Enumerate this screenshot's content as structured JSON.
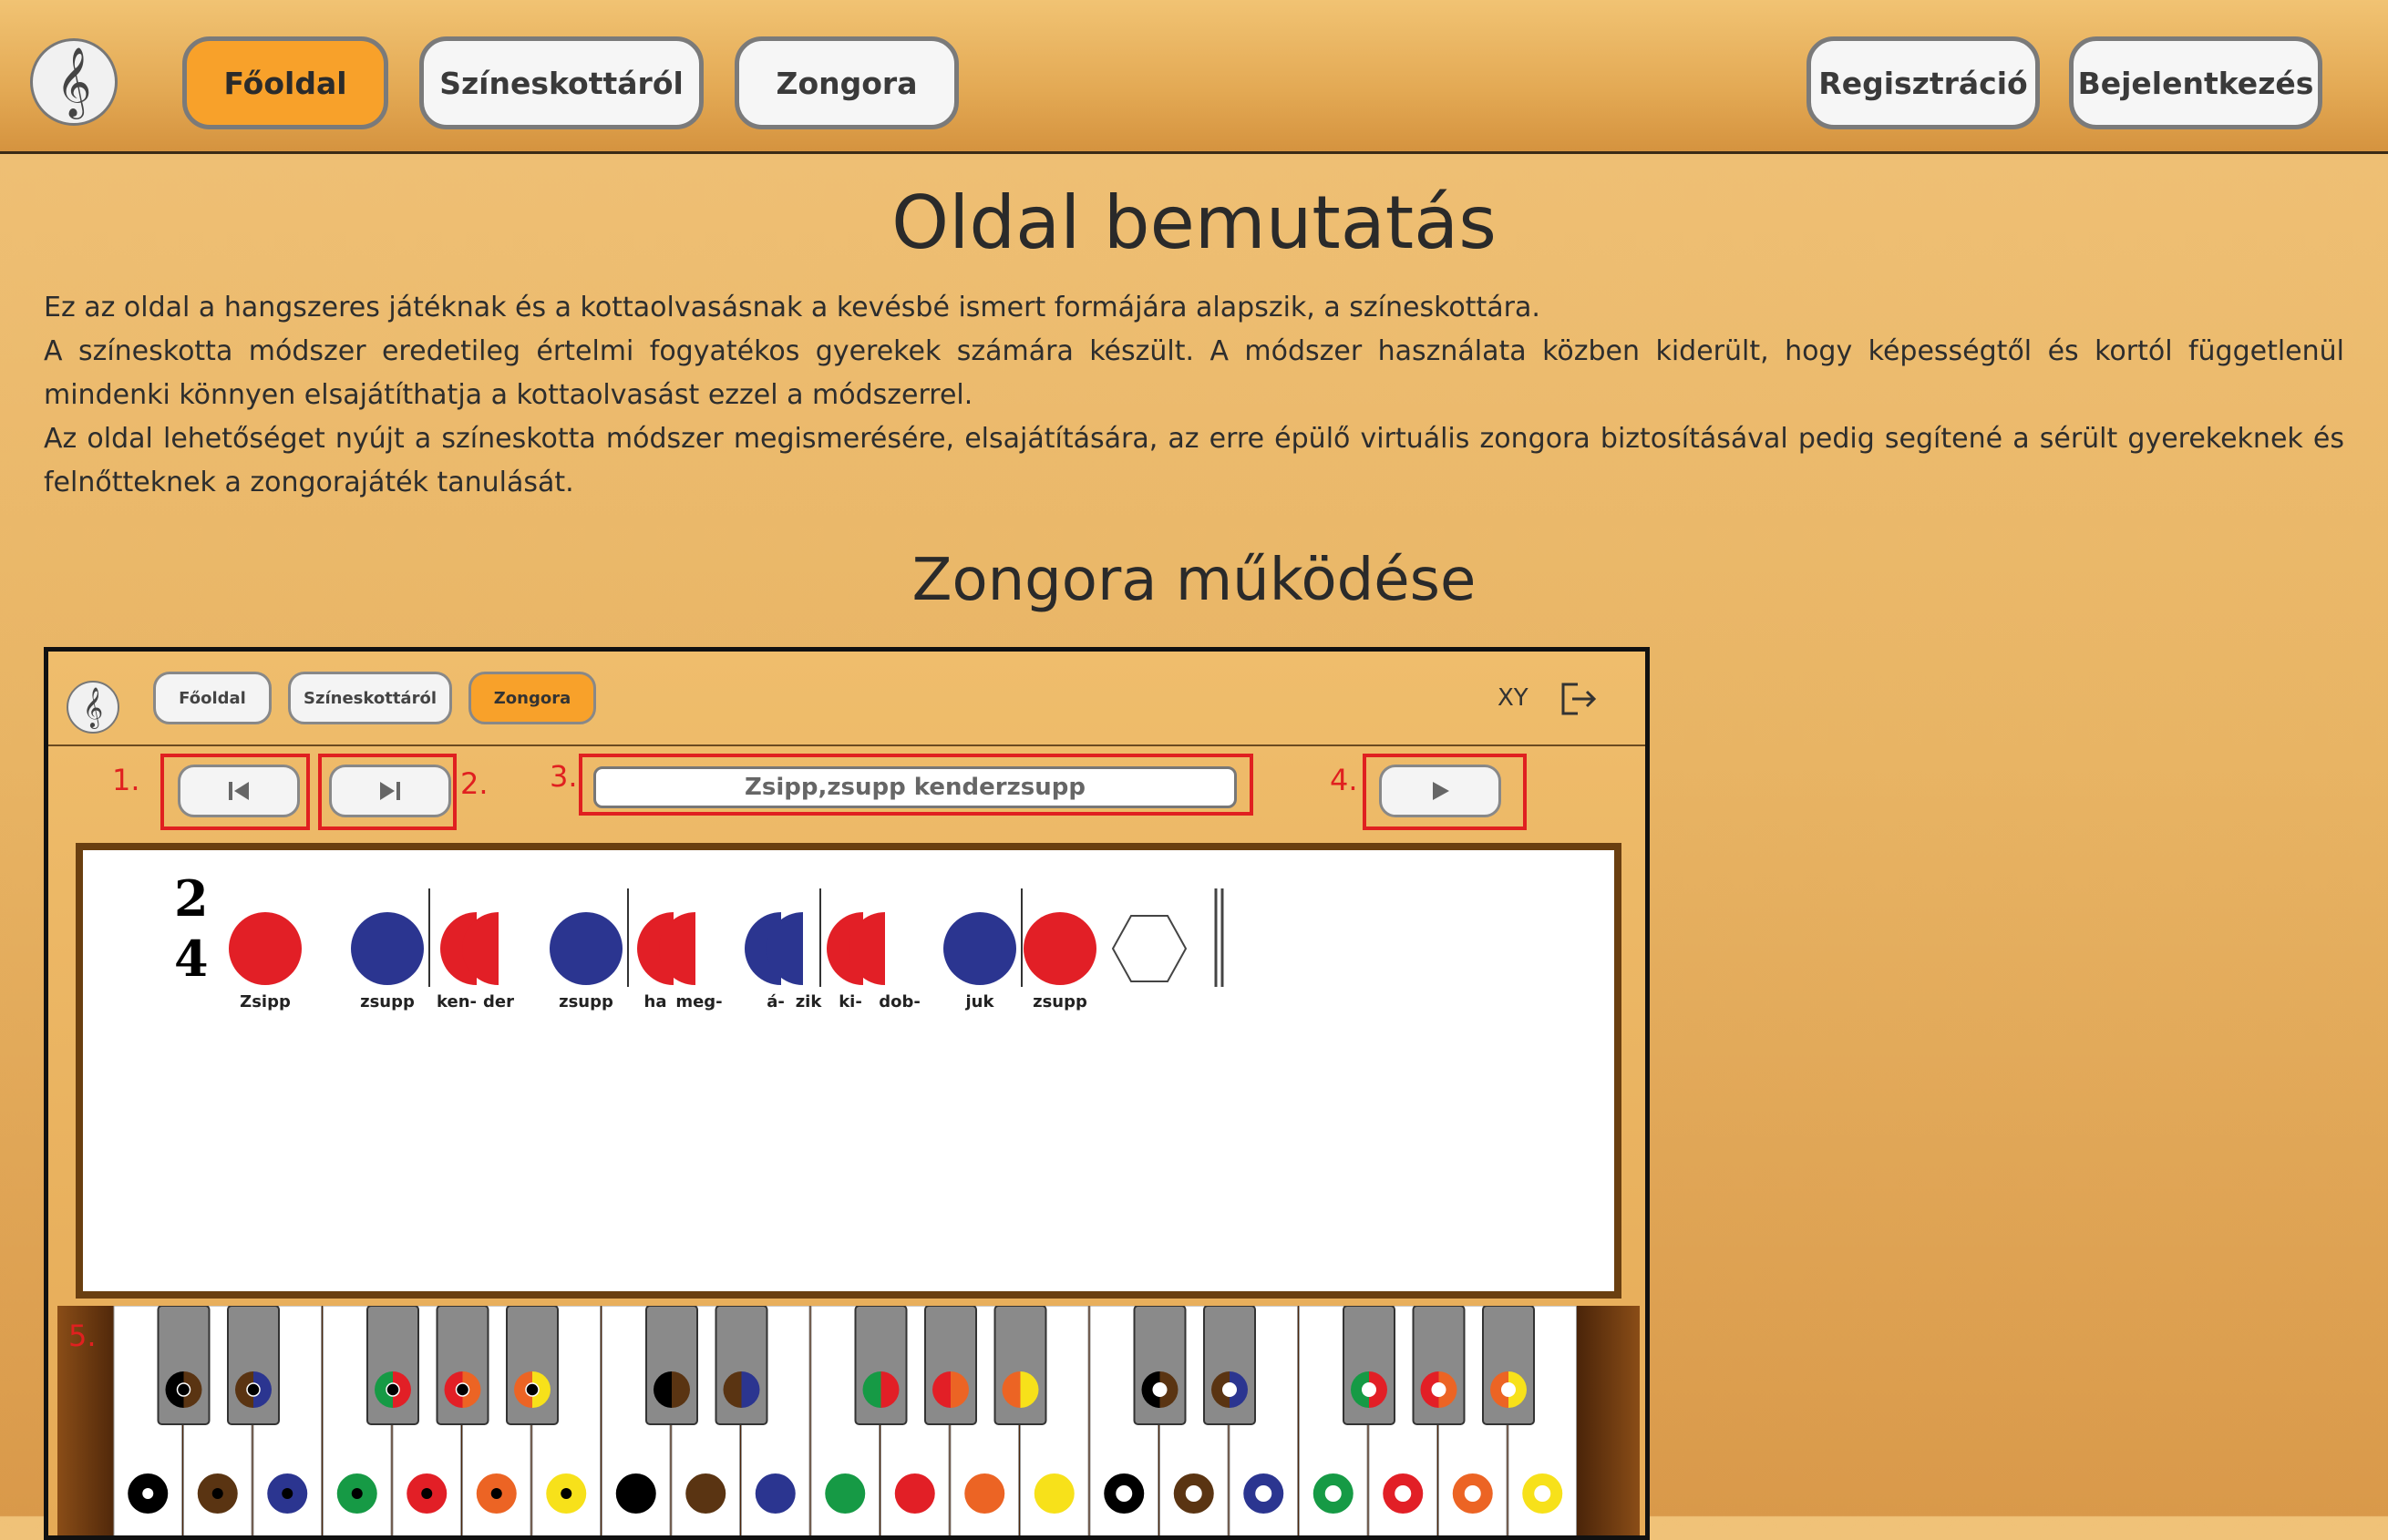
{
  "nav": {
    "logo_icon": "treble-clef-icon",
    "items": [
      {
        "label": "Főoldal",
        "active": true
      },
      {
        "label": "Színeskottáról",
        "active": false
      },
      {
        "label": "Zongora",
        "active": false
      }
    ],
    "register_label": "Regisztráció",
    "login_label": "Bejelentkezés"
  },
  "main": {
    "title": "Oldal bemutatás",
    "paragraphs": [
      "Ez az oldal a hangszeres játéknak és a kottaolvasásnak a kevésbé ismert formájára alapszik, a színeskottára.",
      "A színeskotta módszer eredetileg értelmi fogyatékos gyerekek számára készült. A módszer használata közben kiderült, hogy képességtől és kortól függetlenül mindenki könnyen elsajátíthatja a kottaolvasást ezzel a módszerrel.",
      "Az oldal lehetőséget nyújt a színeskotta módszer megismerésére, elsajátítására, az erre épülő virtuális zongora biztosításával pedig segítené a sérült gyerekeknek és felnőtteknek a zongorajáték tanulását."
    ],
    "subtitle": "Zongora működése"
  },
  "screenshot": {
    "nav": {
      "items": [
        "Főoldal",
        "Színeskottáról",
        "Zongora"
      ],
      "active_index": 2,
      "user": "XY",
      "logout_icon": "logout-icon"
    },
    "controls": {
      "prev_icon": "skip-back-icon",
      "next_icon": "skip-forward-icon",
      "play_icon": "play-icon",
      "song_title": "Zsipp,zsupp kenderzsupp"
    },
    "markers": [
      "1.",
      "2.",
      "3.",
      "4.",
      "5."
    ],
    "score": {
      "time_signature": [
        "2",
        "4"
      ],
      "syllables": [
        "Zsipp",
        "zsupp",
        "ken-",
        "der",
        "zsupp",
        "ha",
        "meg-",
        "á-",
        "zik",
        "ki-",
        "dob-",
        "juk",
        "zsupp"
      ]
    },
    "colors": {
      "red": "#e21f26",
      "blue": "#2b3590",
      "black": "#000000",
      "brown": "#5a3412",
      "green": "#169a45",
      "orange": "#ec6424",
      "yellow": "#f7e11a"
    }
  }
}
